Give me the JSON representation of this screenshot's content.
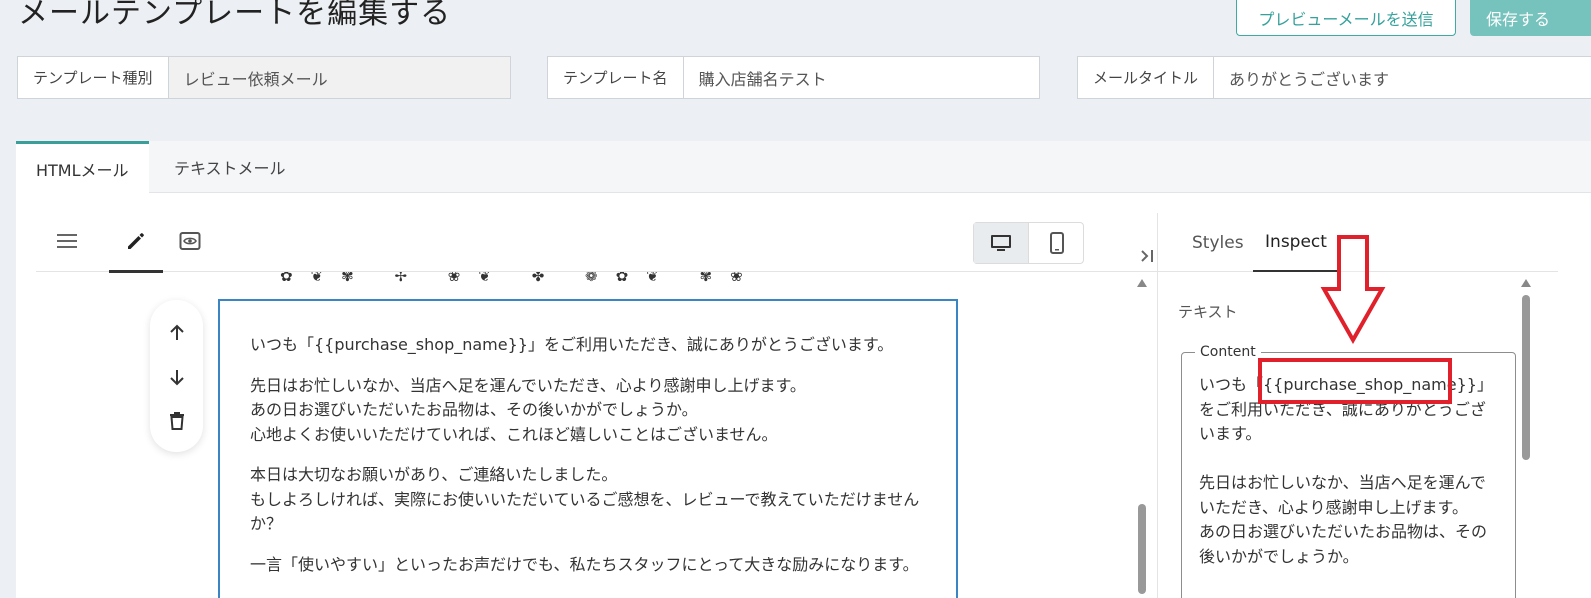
{
  "header": {
    "title": "メールテンプレートを編集する",
    "preview_button": "プレビューメールを送信",
    "save_button": "保存する"
  },
  "fields": {
    "template_type": {
      "label": "テンプレート種別",
      "value": "レビュー依頼メール"
    },
    "template_name": {
      "label": "テンプレート名",
      "value": "購入店舗名テスト"
    },
    "mail_title": {
      "label": "メールタイトル",
      "value": "ありがとうございます"
    }
  },
  "tabs": {
    "html": "HTMLメール",
    "text": "テキストメール"
  },
  "editor": {
    "content_paragraphs": [
      "いつも「{{purchase_shop_name}}」をご利用いただき、誠にありがとうございます。",
      "先日はお忙しいなか、当店へ足を運んでいただき、心より感謝申し上げます。\nあの日お選びいただいたお品物は、その後いかがでしょうか。\n心地よくお使いいただけていれば、これほど嬉しいことはございません。",
      "本日は大切なお願いがあり、ご連絡いたしました。\nもしよろしければ、実際にお使いいただいているご感想を、レビューで教えていただけませんか？",
      "一言「使いやすい」といったお声だけでも、私たちスタッフにとって大きな励みになります。"
    ]
  },
  "panel": {
    "tab_styles": "Styles",
    "tab_inspect": "Inspect",
    "section_label": "テキスト",
    "content_legend": "Content",
    "content_text": "いつも「{{purchase_shop_name}}」をご利用いただき、誠にありがとうございます。\n\n先日はお忙しいなか、当店へ足を運んでいただき、心より感謝申し上げます。\nあの日お選びいただいたお品物は、その後いかがでしょうか。"
  },
  "icons": {
    "menu": "hamburger-icon",
    "edit": "pencil-icon",
    "preview": "eye-icon",
    "desktop": "monitor-icon",
    "mobile": "phone-icon",
    "collapse": "collapse-panel-icon",
    "move_up": "arrow-up-icon",
    "move_down": "arrow-down-icon",
    "delete": "trash-icon"
  },
  "colors": {
    "accent": "#3a9f99",
    "highlight": "#e0202a",
    "selection": "#3a86c4"
  }
}
